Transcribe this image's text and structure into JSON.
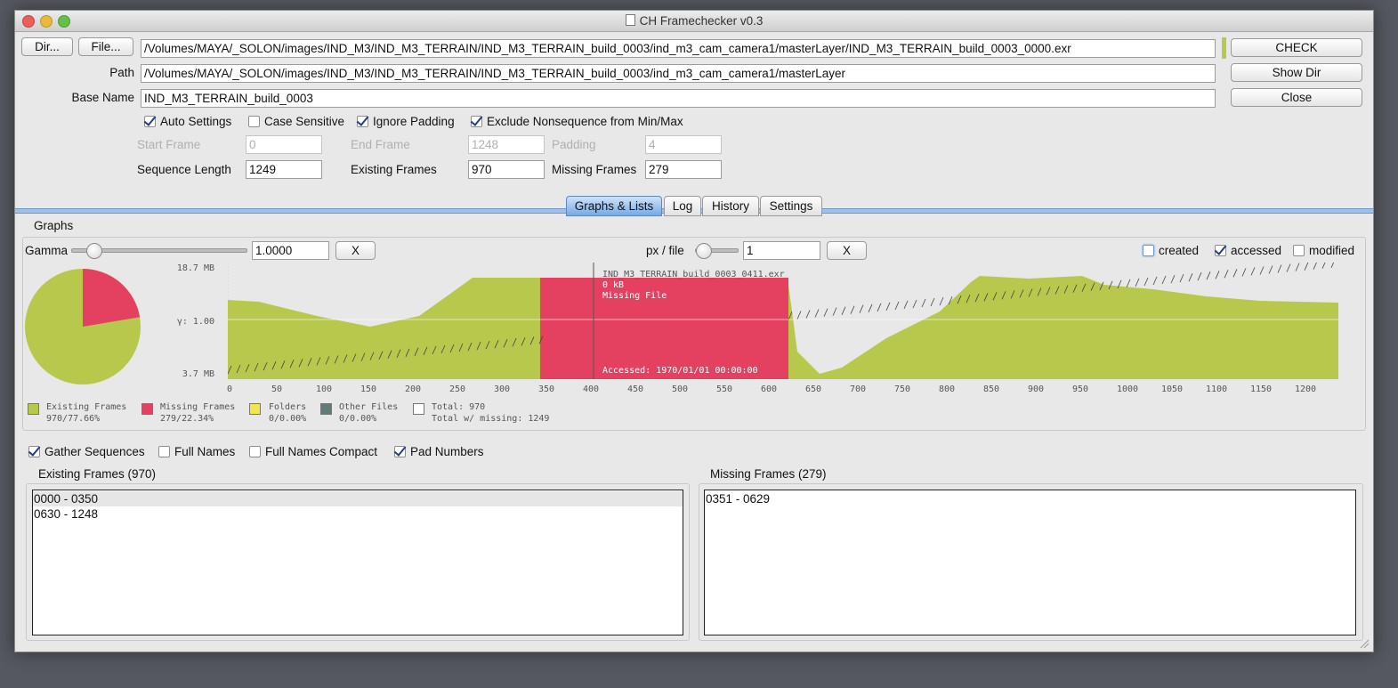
{
  "window": {
    "title": "CH Framechecker v0.3"
  },
  "top": {
    "dir_button": "Dir...",
    "file_button": "File...",
    "file_path": "/Volumes/MAYA/_SOLON/images/IND_M3/IND_M3_TERRAIN/IND_M3_TERRAIN_build_0003/ind_m3_cam_camera1/masterLayer/IND_M3_TERRAIN_build_0003_0000.exr",
    "check_button": "CHECK",
    "path_label": "Path",
    "path_value": "/Volumes/MAYA/_SOLON/images/IND_M3/IND_M3_TERRAIN/IND_M3_TERRAIN_build_0003/ind_m3_cam_camera1/masterLayer",
    "show_dir_button": "Show Dir",
    "basename_label": "Base Name",
    "basename_value": "IND_M3_TERRAIN_build_0003",
    "close_button": "Close"
  },
  "options": {
    "auto_settings": "Auto Settings",
    "case_sensitive": "Case Sensitive",
    "ignore_padding": "Ignore Padding",
    "exclude_nonsequence": "Exclude Nonsequence from Min/Max",
    "start_frame_label": "Start Frame",
    "start_frame_value": "0",
    "end_frame_label": "End Frame",
    "end_frame_value": "1248",
    "padding_label": "Padding",
    "padding_value": "4",
    "sequence_length_label": "Sequence Length",
    "sequence_length_value": "1249",
    "existing_frames_label": "Existing Frames",
    "existing_frames_value": "970",
    "missing_frames_label": "Missing Frames",
    "missing_frames_value": "279"
  },
  "tabs": [
    "Graphs & Lists",
    "Log",
    "History",
    "Settings"
  ],
  "graphs": {
    "section_label": "Graphs",
    "gamma_label": "Gamma",
    "gamma_value": "1.0000",
    "gamma_reset": "X",
    "pxfile_label": "px / file",
    "pxfile_value": "1",
    "pxfile_reset": "X",
    "created_label": "created",
    "accessed_label": "accessed",
    "modified_label": "modified",
    "y_top": "18.7 MB",
    "y_mid": "γ: 1.00",
    "y_bottom": "3.7 MB",
    "tooltip": {
      "file": "IND_M3_TERRAIN_build_0003_0411.exr",
      "size": "0 kB",
      "status": "Missing File",
      "accessed": "Accessed: 1970/01/01 00:00:00"
    },
    "legend": [
      {
        "label": "Existing Frames",
        "value": "970/77.66%",
        "color": "#b8c84c"
      },
      {
        "label": "Missing Frames",
        "value": "279/22.34%",
        "color": "#e3415f"
      },
      {
        "label": "Folders",
        "value": "0/0.00%",
        "color": "#f2e64a"
      },
      {
        "label": "Other Files",
        "value": "0/0.00%",
        "color": "#5f7d78"
      },
      {
        "label": "Total: 970",
        "value": "Total w/ missing: 1249",
        "color": "#ffffff"
      }
    ],
    "x_ticks": [
      "0",
      "50",
      "100",
      "150",
      "200",
      "250",
      "300",
      "350",
      "400",
      "450",
      "500",
      "550",
      "600",
      "650",
      "700",
      "750",
      "800",
      "850",
      "900",
      "950",
      "1000",
      "1050",
      "1100",
      "1150",
      "1200"
    ]
  },
  "chart_data": {
    "type": "area",
    "x_range": [
      0,
      1248
    ],
    "x_ticks": [
      0,
      50,
      100,
      150,
      200,
      250,
      300,
      350,
      400,
      450,
      500,
      550,
      600,
      650,
      700,
      750,
      800,
      850,
      900,
      950,
      1000,
      1050,
      1100,
      1150,
      1200
    ],
    "y_label_top": "18.7 MB",
    "y_label_bottom": "3.7 MB",
    "missing_range": [
      351,
      629
    ],
    "pie": [
      {
        "name": "Existing Frames",
        "value": 970,
        "percent": 77.66,
        "color": "#b8c84c"
      },
      {
        "name": "Missing Frames",
        "value": 279,
        "percent": 22.34,
        "color": "#e3415f"
      }
    ]
  },
  "lists": {
    "gather_sequences": "Gather Sequences",
    "full_names": "Full Names",
    "full_names_compact": "Full Names Compact",
    "pad_numbers": "Pad Numbers",
    "existing_title": "Existing Frames (970)",
    "existing_items": [
      "0000 - 0350",
      "0630 - 1248"
    ],
    "missing_title": "Missing Frames (279)",
    "missing_items": [
      "0351 - 0629"
    ]
  }
}
